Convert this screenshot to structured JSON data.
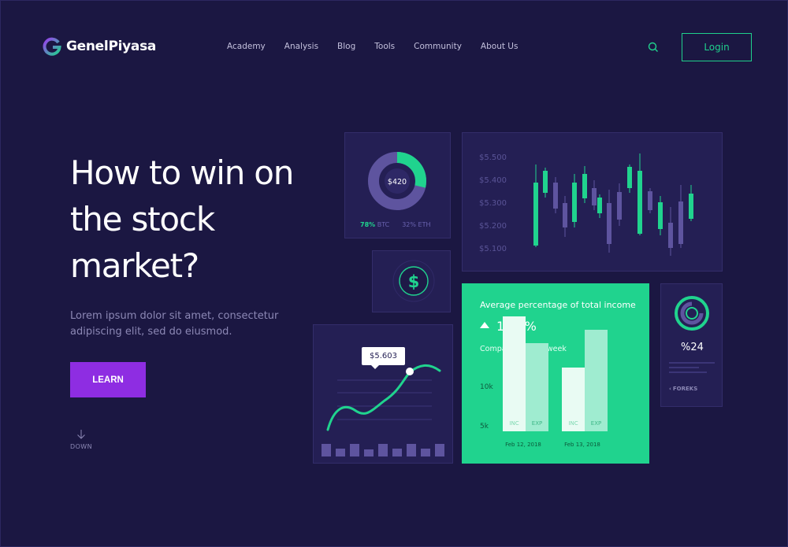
{
  "brand": {
    "name": "GenelPiyasa",
    "accent": "#20d38e",
    "purple": "#8e2de2",
    "background": "#1b1742"
  },
  "nav": {
    "items": [
      "Academy",
      "Analysis",
      "Blog",
      "Tools",
      "Community",
      "About Us"
    ],
    "search_icon": "search-icon",
    "login_label": "Login"
  },
  "hero": {
    "title": "How to win on the stock market?",
    "subtitle": "Lorem ipsum dolor sit amet, consectetur adipiscing elit, sed do eiusmod.",
    "cta_label": "LEARN",
    "scroll_label": "DOWN"
  },
  "donut_card": {
    "center_value": "$420",
    "legend": [
      {
        "pct": "78%",
        "label": "BTC"
      },
      {
        "pct": "32%",
        "label": "ETH"
      }
    ]
  },
  "candlestick_card": {
    "price_labels": [
      "$5.500",
      "$5.400",
      "$5.300",
      "$5.200",
      "$5.100"
    ]
  },
  "dollar_card": {
    "icon": "dollar-icon"
  },
  "line_card": {
    "tooltip_value": "$5.603"
  },
  "income_card": {
    "title": "Average percentage of total income",
    "change": "11.2%",
    "compare_label": "Compared to last week",
    "y_ticks": [
      "10k",
      "5k"
    ],
    "groups": [
      {
        "date": "Feb 12, 2018",
        "inc_label": "INC",
        "exp_label": "EXP",
        "inc": 14.6,
        "exp": 11.2
      },
      {
        "date": "Feb 13, 2018",
        "inc_label": "INC",
        "exp_label": "EXP",
        "inc": 8.1,
        "exp": 12.9
      }
    ]
  },
  "ring_card": {
    "value": "%24",
    "source_label": "FOREKS"
  }
}
